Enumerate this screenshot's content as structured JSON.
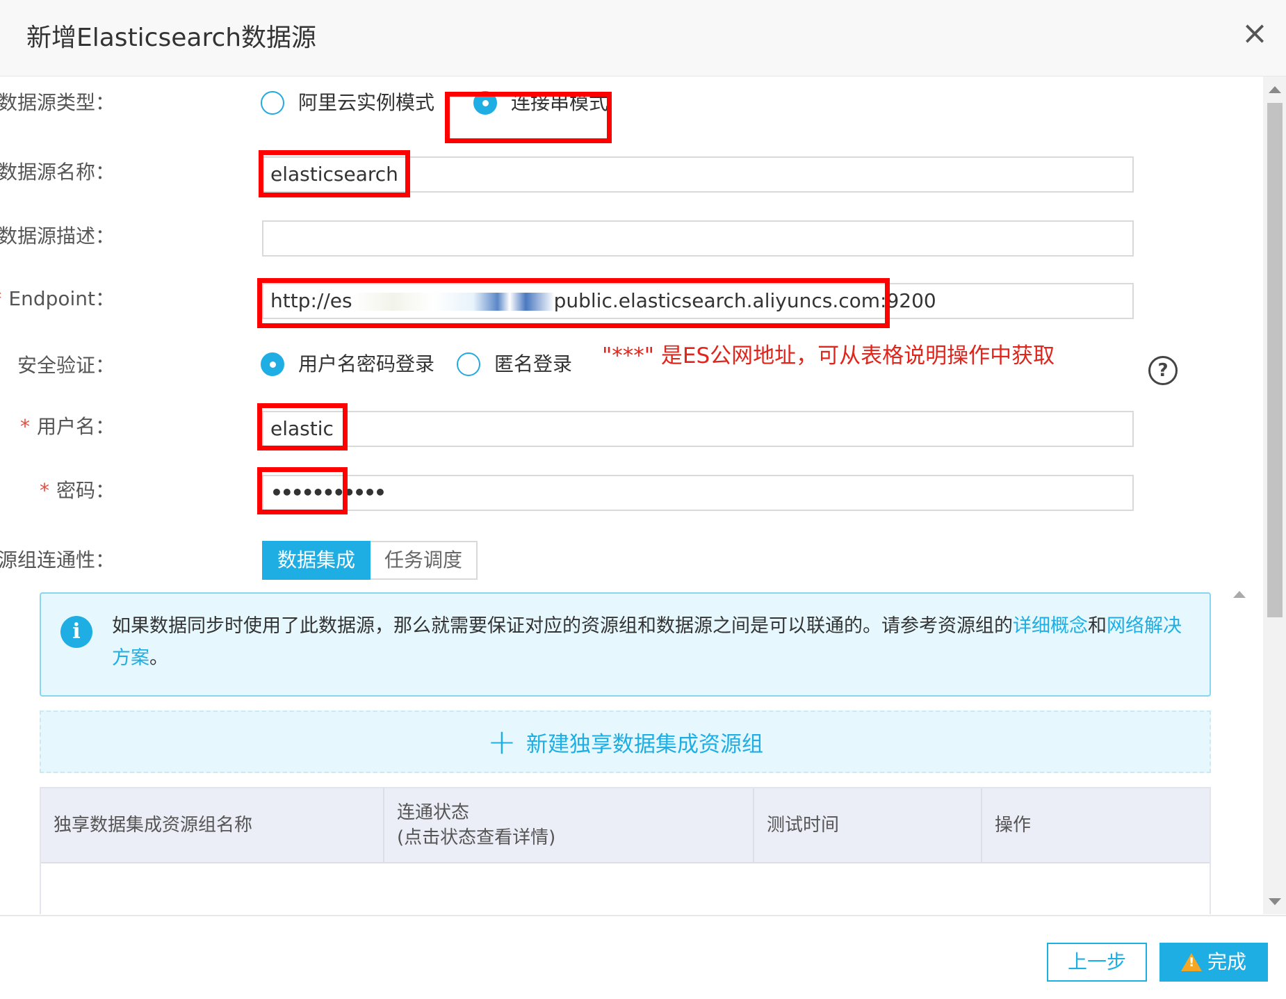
{
  "dialog": {
    "title": "新增Elasticsearch数据源",
    "close_icon": "close-icon"
  },
  "form": {
    "ds_type": {
      "label": "数据源类型：",
      "options": [
        "阿里云实例模式",
        "连接串模式"
      ],
      "selected": "连接串模式"
    },
    "ds_name": {
      "label": "数据源名称：",
      "value": "elasticsearch"
    },
    "ds_desc": {
      "label": "数据源描述：",
      "value": ""
    },
    "endpoint": {
      "label": "Endpoint：",
      "value_prefix": "http://es",
      "value_suffix": "public.elasticsearch.aliyuncs.com:9200"
    },
    "auth": {
      "label": "安全验证：",
      "options": [
        "用户名密码登录",
        "匿名登录"
      ],
      "selected": "用户名密码登录"
    },
    "annotation": "\"***\"   是ES公网地址，可从表格说明操作中获取",
    "username": {
      "label": "用户名：",
      "value": "elastic"
    },
    "password": {
      "label": "密码：",
      "value": "•••••••••••"
    },
    "connectivity": {
      "label": "资源组连通性：",
      "tabs": [
        "数据集成",
        "任务调度"
      ],
      "active": "数据集成"
    }
  },
  "info": {
    "text_1": "如果数据同步时使用了此数据源，那么就需要保证对应的资源组和数据源之间是可以联通的。请参考资源组的",
    "link_1": "详细概念",
    "text_2": "和",
    "link_2": "网络解决方案",
    "text_3": "。"
  },
  "add_group": {
    "label": "新建独享数据集成资源组"
  },
  "table": {
    "headers": [
      [
        "独享数据集成资源组名称"
      ],
      [
        "连通状态",
        "(点击状态查看详情)"
      ],
      [
        "测试时间"
      ],
      [
        "操作"
      ]
    ]
  },
  "footer": {
    "prev_label": "上一步",
    "done_label": "完成"
  },
  "colors": {
    "accent": "#1eaee3",
    "annotation_red": "#ff0000",
    "required": "#e74c3c"
  }
}
